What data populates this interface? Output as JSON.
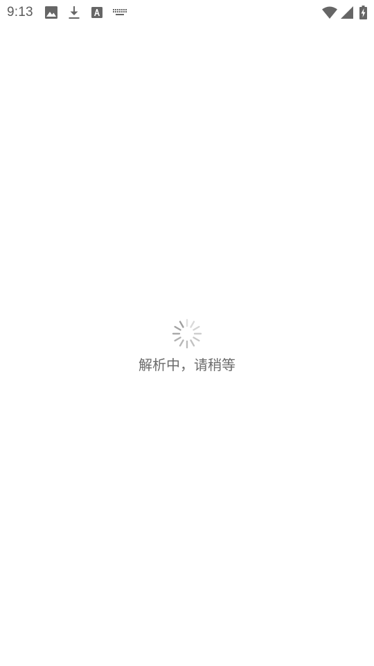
{
  "status_bar": {
    "time": "9:13",
    "notification_icons": [
      "image-icon",
      "download-icon",
      "text-a-icon",
      "keyboard-icon"
    ],
    "system_icons": [
      "wifi-icon",
      "cell-signal-icon",
      "battery-charging-icon"
    ],
    "icon_color": "#666666"
  },
  "main": {
    "loading_text": "解析中，请稍等",
    "spinner_color": "#9e9e9e",
    "background": "#ffffff"
  }
}
